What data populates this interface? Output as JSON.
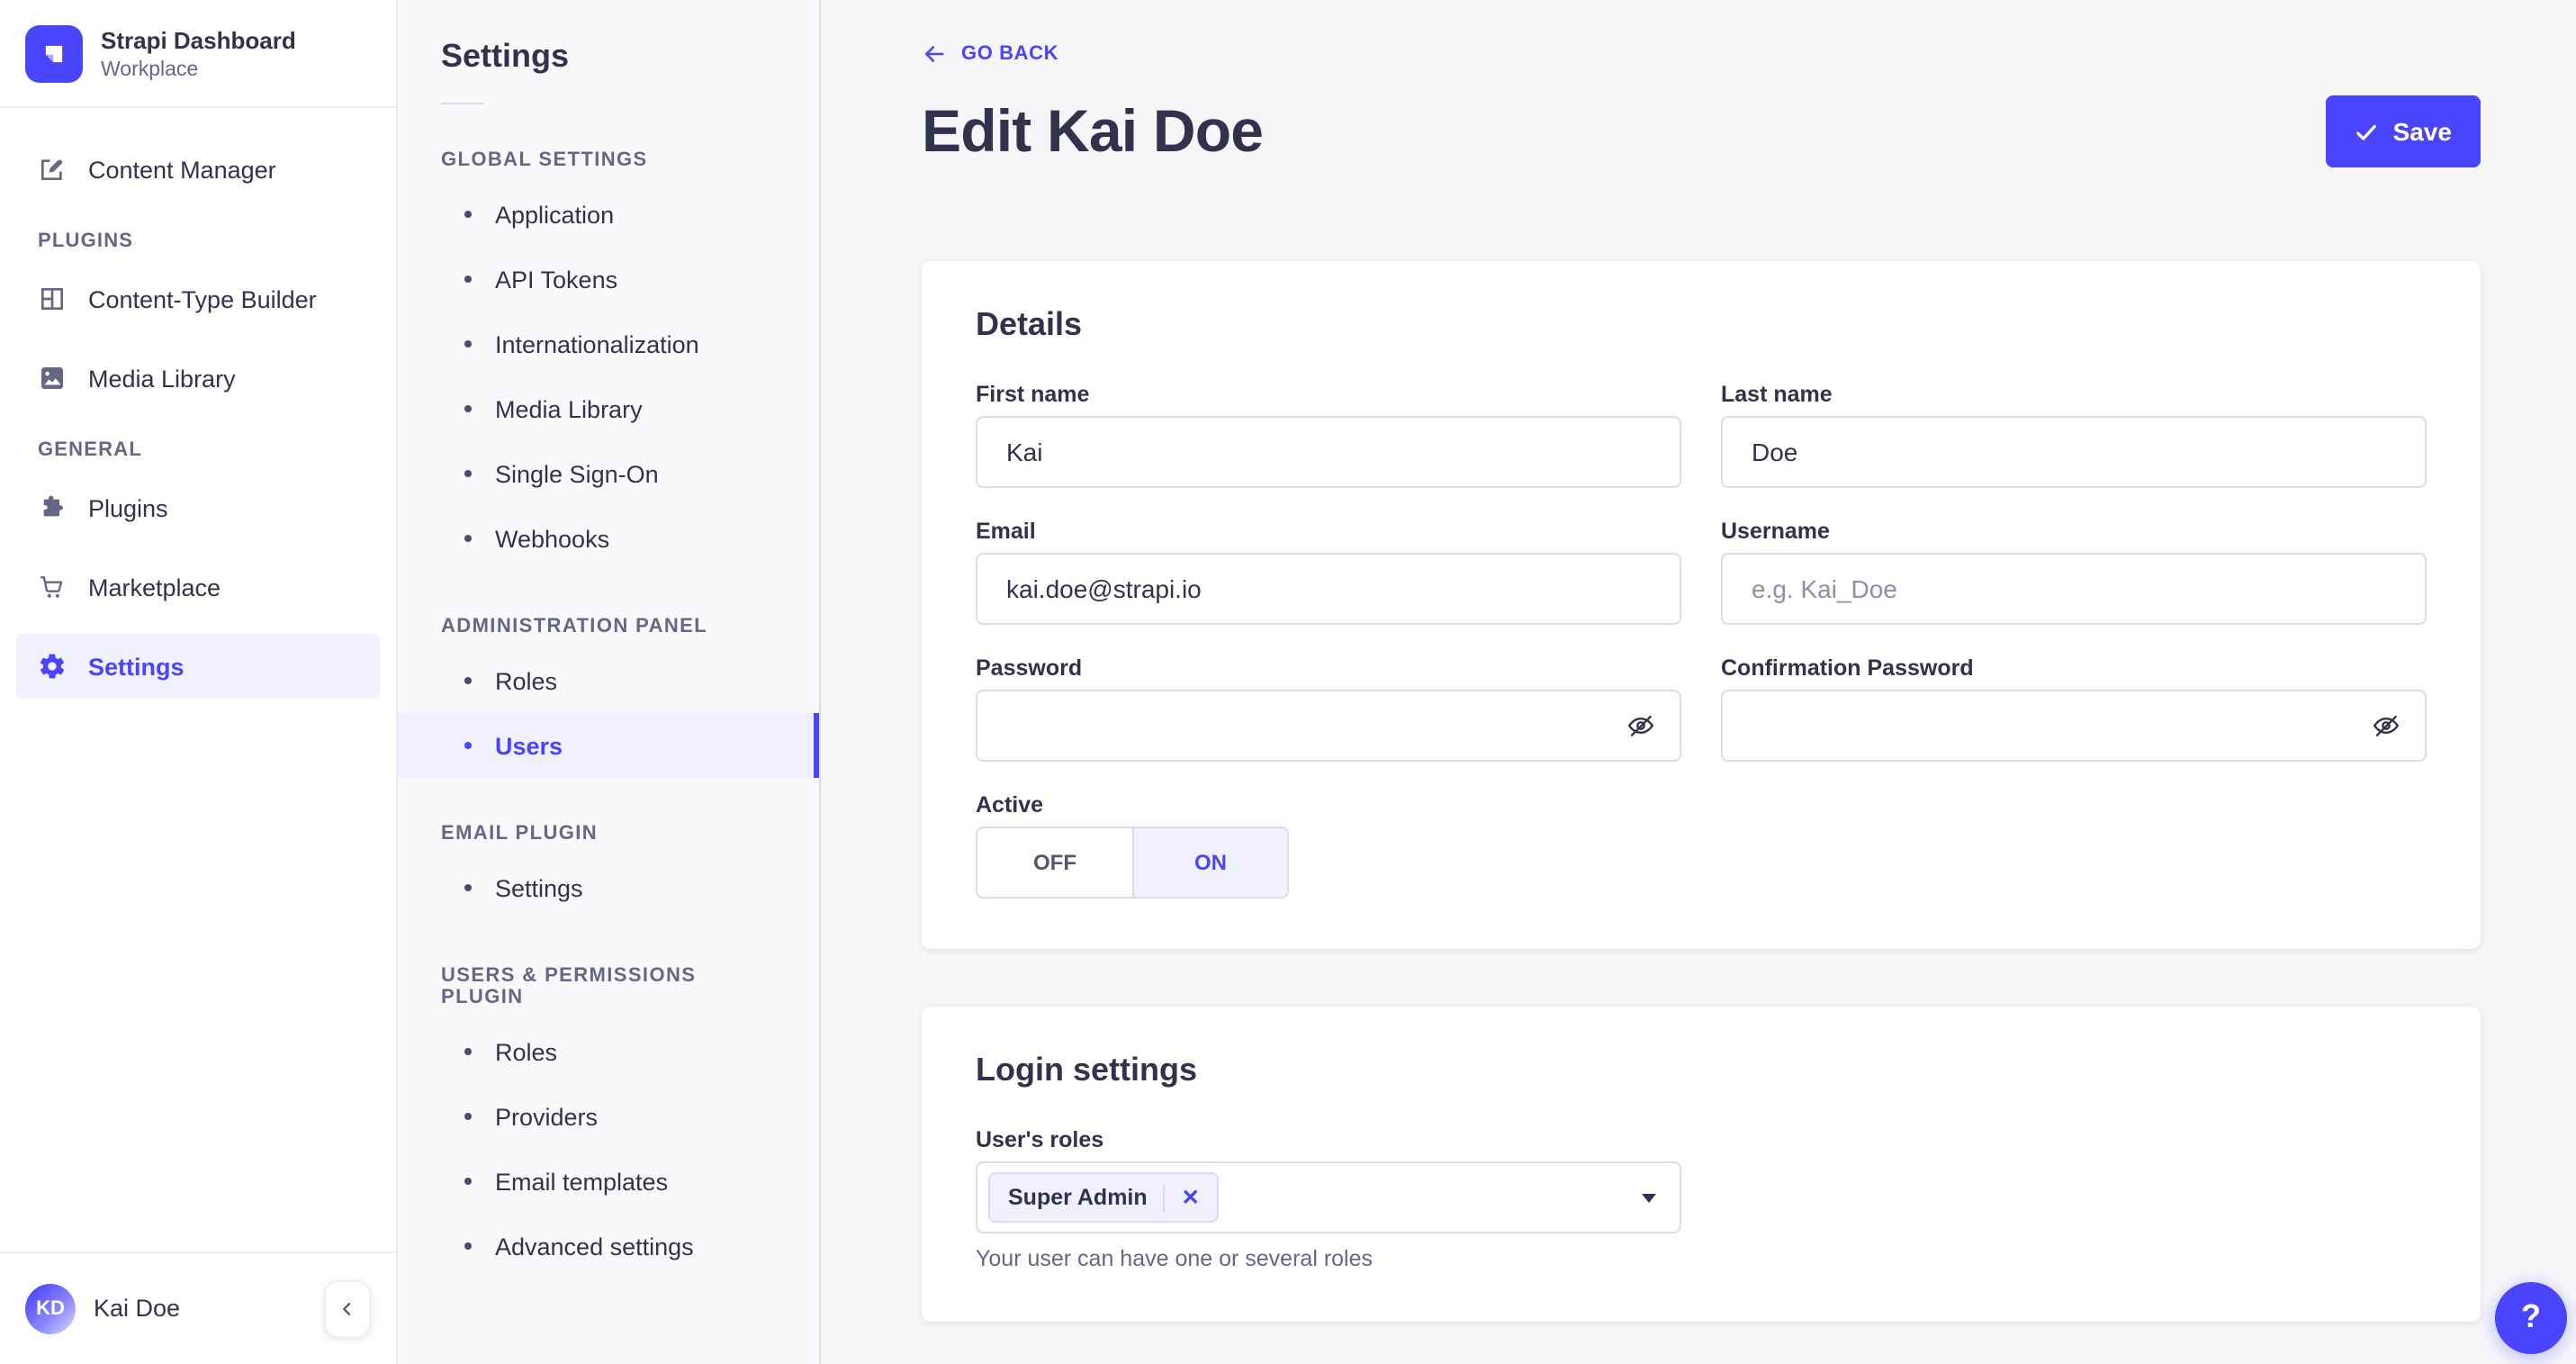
{
  "colors": {
    "primary": "#4945ff",
    "primary_light": "#f0f0ff",
    "text_dark": "#32324d",
    "text_muted": "#666687",
    "border": "#dcdce4",
    "page_background": "#f6f6f9"
  },
  "sidebar": {
    "brand": {
      "title": "Strapi Dashboard",
      "subtitle": "Workplace"
    },
    "workspace_item": {
      "label": "Content Manager",
      "icon": "feather-pen-icon"
    },
    "sections": [
      {
        "header": "PLUGINS",
        "items": [
          {
            "label": "Content-Type Builder",
            "icon": "layout-icon"
          },
          {
            "label": "Media Library",
            "icon": "picture-icon"
          }
        ]
      },
      {
        "header": "GENERAL",
        "items": [
          {
            "label": "Plugins",
            "icon": "puzzle-icon"
          },
          {
            "label": "Marketplace",
            "icon": "cart-icon"
          },
          {
            "label": "Settings",
            "icon": "gear-icon",
            "active": true
          }
        ]
      }
    ],
    "footer": {
      "initials": "KD",
      "name": "Kai Doe"
    }
  },
  "subnav": {
    "title": "Settings",
    "sections": [
      {
        "header": "GLOBAL SETTINGS",
        "items": [
          "Application",
          "API Tokens",
          "Internationalization",
          "Media Library",
          "Single Sign-On",
          "Webhooks"
        ]
      },
      {
        "header": "ADMINISTRATION PANEL",
        "items": [
          "Roles",
          "Users"
        ],
        "active_item": "Users"
      },
      {
        "header": "EMAIL PLUGIN",
        "items": [
          "Settings"
        ]
      },
      {
        "header": "USERS & PERMISSIONS PLUGIN",
        "items": [
          "Roles",
          "Providers",
          "Email templates",
          "Advanced settings"
        ]
      }
    ]
  },
  "main": {
    "go_back": "GO BACK",
    "title": "Edit Kai Doe",
    "save_button": "Save",
    "details_card": {
      "heading": "Details",
      "first_name": {
        "label": "First name",
        "value": "Kai"
      },
      "last_name": {
        "label": "Last name",
        "value": "Doe"
      },
      "email": {
        "label": "Email",
        "value": "kai.doe@strapi.io"
      },
      "username": {
        "label": "Username",
        "placeholder": "e.g. Kai_Doe",
        "value": ""
      },
      "password": {
        "label": "Password",
        "value": ""
      },
      "confirmation_password": {
        "label": "Confirmation Password",
        "value": ""
      },
      "active": {
        "label": "Active",
        "off": "OFF",
        "on": "ON",
        "state": "ON"
      }
    },
    "login_card": {
      "heading": "Login settings",
      "roles_label": "User's roles",
      "selected_role": "Super Admin",
      "remove_role_icon": "✕",
      "helper": "Your user can have one or several roles"
    },
    "help_button": "?"
  }
}
